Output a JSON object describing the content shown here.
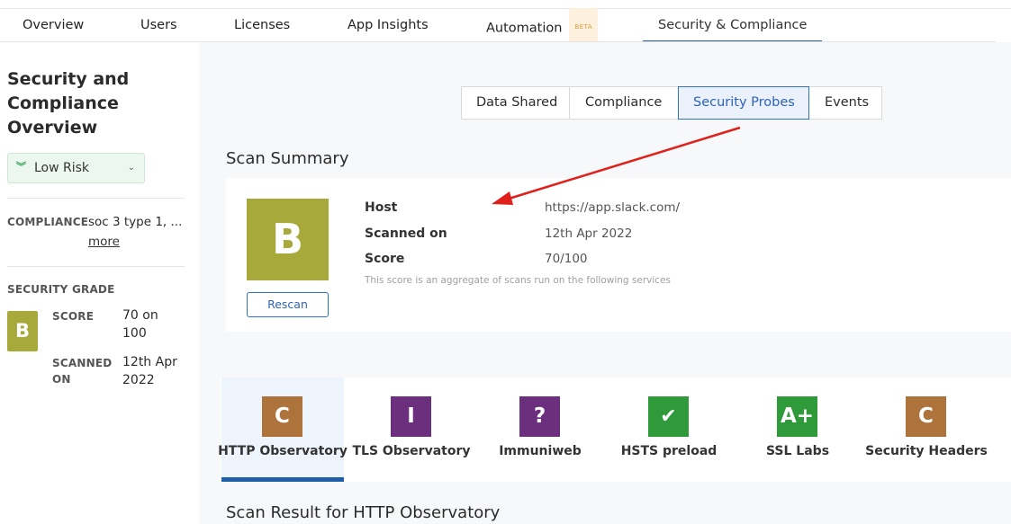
{
  "nav": {
    "tabs": [
      {
        "label": "Overview"
      },
      {
        "label": "Users"
      },
      {
        "label": "Licenses"
      },
      {
        "label": "App Insights"
      },
      {
        "label": "Automation",
        "badge": "BETA"
      },
      {
        "label": "Security & Compliance",
        "active": true
      }
    ]
  },
  "sidebar": {
    "title": "Security and Compliance Overview",
    "risk": {
      "label": "Low Risk",
      "icon": "double-chevron-down-icon",
      "color": "#3aa65c"
    },
    "compliance": {
      "label": "COMPLIANCE",
      "value": "soc 3 type 1, ...",
      "more": "more"
    },
    "security_grade": {
      "label": "SECURITY GRADE",
      "grade": "B",
      "grade_color": "#a8a93b",
      "score_label": "SCORE",
      "score_value": "70 on 100",
      "scanned_label": "SCANNED ON",
      "scanned_value": "12th Apr 2022"
    }
  },
  "subtabs": [
    {
      "label": "Data Shared"
    },
    {
      "label": "Compliance"
    },
    {
      "label": "Security Probes",
      "active": true
    },
    {
      "label": "Events"
    }
  ],
  "scan_summary": {
    "title": "Scan Summary",
    "grade": "B",
    "grade_color": "#a8a93b",
    "rescan_label": "Rescan",
    "host_label": "Host",
    "host_value": "https://app.slack.com/",
    "scanned_label": "Scanned on",
    "scanned_value": "12th Apr 2022",
    "score_label": "Score",
    "score_value": "70/100",
    "note": "This score is an aggregate of scans run on the following services"
  },
  "services": [
    {
      "label": "HTTP Observatory",
      "grade": "C",
      "color": "#ad733a",
      "active": true
    },
    {
      "label": "TLS Observatory",
      "grade": "I",
      "color": "#6b2f7e"
    },
    {
      "label": "Immuniweb",
      "grade": "?",
      "color": "#6b2f7e"
    },
    {
      "label": "HSTS preload",
      "grade": "✔",
      "color": "#2f9a3a",
      "icon": "check-icon"
    },
    {
      "label": "SSL Labs",
      "grade": "A+",
      "color": "#2f9a3a"
    },
    {
      "label": "Security Headers",
      "grade": "C",
      "color": "#ad733a"
    }
  ],
  "result": {
    "title": "Scan Result for HTTP Observatory"
  },
  "annotation": {
    "color": "#e0201b"
  }
}
